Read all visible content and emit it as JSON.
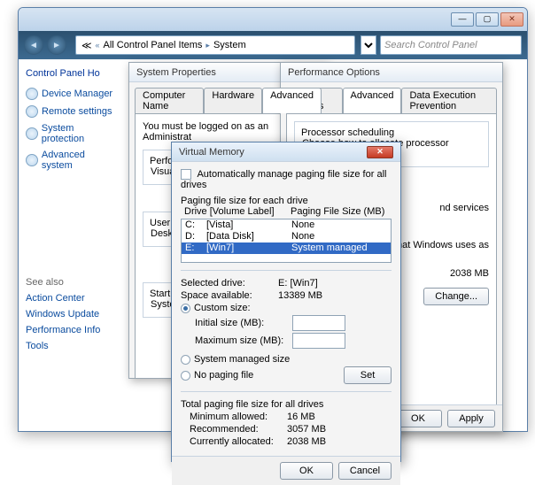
{
  "window": {
    "breadcrumb_root_icon": "≪",
    "breadcrumb1": "All Control Panel Items",
    "breadcrumb2": "System",
    "search_placeholder": "Search Control Panel"
  },
  "sidebar": {
    "head": "Control Panel Ho",
    "items": [
      "Device Manager",
      "Remote settings",
      "System protection",
      "Advanced system"
    ],
    "seealso_head": "See also",
    "seealso": [
      "Action Center",
      "Windows Update",
      "Performance Info",
      "Tools"
    ]
  },
  "sysprops": {
    "title": "System Properties",
    "tabs": [
      "Computer Name",
      "Hardware",
      "Advanced"
    ],
    "note": "You must be logged on as an Administrat",
    "grp_perf": "Performance",
    "perf_sub": "Visual effec",
    "grp_user": "User Profile",
    "user_sub": "Desktop se",
    "grp_start": "Startup and",
    "start_sub": "System star"
  },
  "perfopts": {
    "title": "Performance Options",
    "tabs": [
      "Visual Effects",
      "Advanced",
      "Data Execution Prevention"
    ],
    "sched_head": "Processor scheduling",
    "sched_txt": "Choose how to allocate processor resources.",
    "vm_frag1": "nd services",
    "vm_frag2": "k that Windows uses as",
    "vm_value": "2038 MB",
    "change_btn": "Change...",
    "ok": "OK",
    "apply": "Apply"
  },
  "vmem": {
    "title": "Virtual Memory",
    "auto_label": "Automatically manage paging file size for all drives",
    "drive_head": "Paging file size for each drive",
    "col_drive": "Drive  [Volume Label]",
    "col_size": "Paging File Size (MB)",
    "drives": [
      {
        "letter": "C:",
        "label": "[Vista]",
        "size": "None",
        "selected": false
      },
      {
        "letter": "D:",
        "label": "[Data Disk]",
        "size": "None",
        "selected": false
      },
      {
        "letter": "E:",
        "label": "[Win7]",
        "size": "System managed",
        "selected": true
      }
    ],
    "sel_drive_label": "Selected drive:",
    "sel_drive_value": "E:  [Win7]",
    "space_label": "Space available:",
    "space_value": "13389 MB",
    "opt_custom": "Custom size:",
    "initial_label": "Initial size (MB):",
    "max_label": "Maximum size (MB):",
    "opt_sys": "System managed size",
    "opt_none": "No paging file",
    "set_btn": "Set",
    "totals_head": "Total paging file size for all drives",
    "min_label": "Minimum allowed:",
    "min_value": "16 MB",
    "rec_label": "Recommended:",
    "rec_value": "3057 MB",
    "cur_label": "Currently allocated:",
    "cur_value": "2038 MB",
    "ok": "OK",
    "cancel": "Cancel"
  }
}
